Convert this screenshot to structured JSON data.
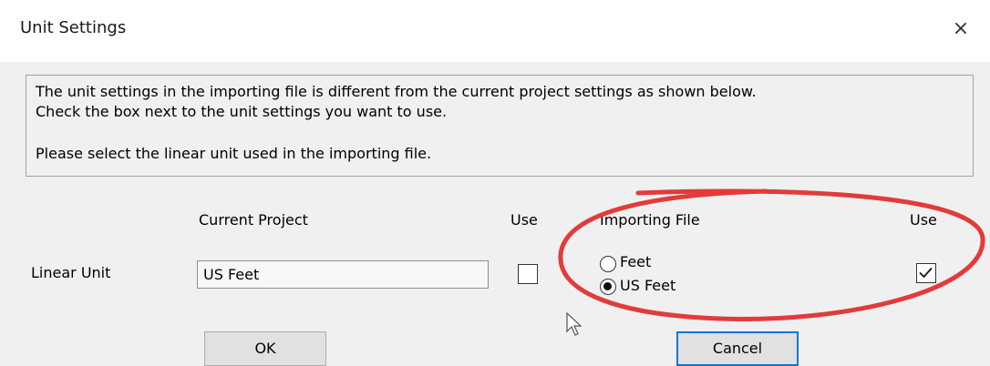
{
  "window": {
    "title": "Unit Settings",
    "close_glyph": "×"
  },
  "message": {
    "line1": "The unit settings in the importing file is different from the current project settings as shown below.",
    "line2": "Check the box next to the unit settings you want to use.",
    "line3": "Please select the linear unit used in the importing file."
  },
  "headers": {
    "current_project": "Current Project",
    "use_left": "Use",
    "importing_file": "Importing File",
    "use_right": "Use"
  },
  "row": {
    "label": "Linear Unit",
    "current_value": "US Feet",
    "current_use_checked": false,
    "importing_options": [
      {
        "label": "Feet",
        "selected": false
      },
      {
        "label": "US Feet",
        "selected": true
      }
    ],
    "importing_use_checked": true
  },
  "buttons": {
    "ok": "OK",
    "cancel": "Cancel"
  },
  "annotation": {
    "color": "#e23b3b"
  },
  "colors": {
    "accent": "#0078d7",
    "client_bg": "#f0f0f0"
  }
}
